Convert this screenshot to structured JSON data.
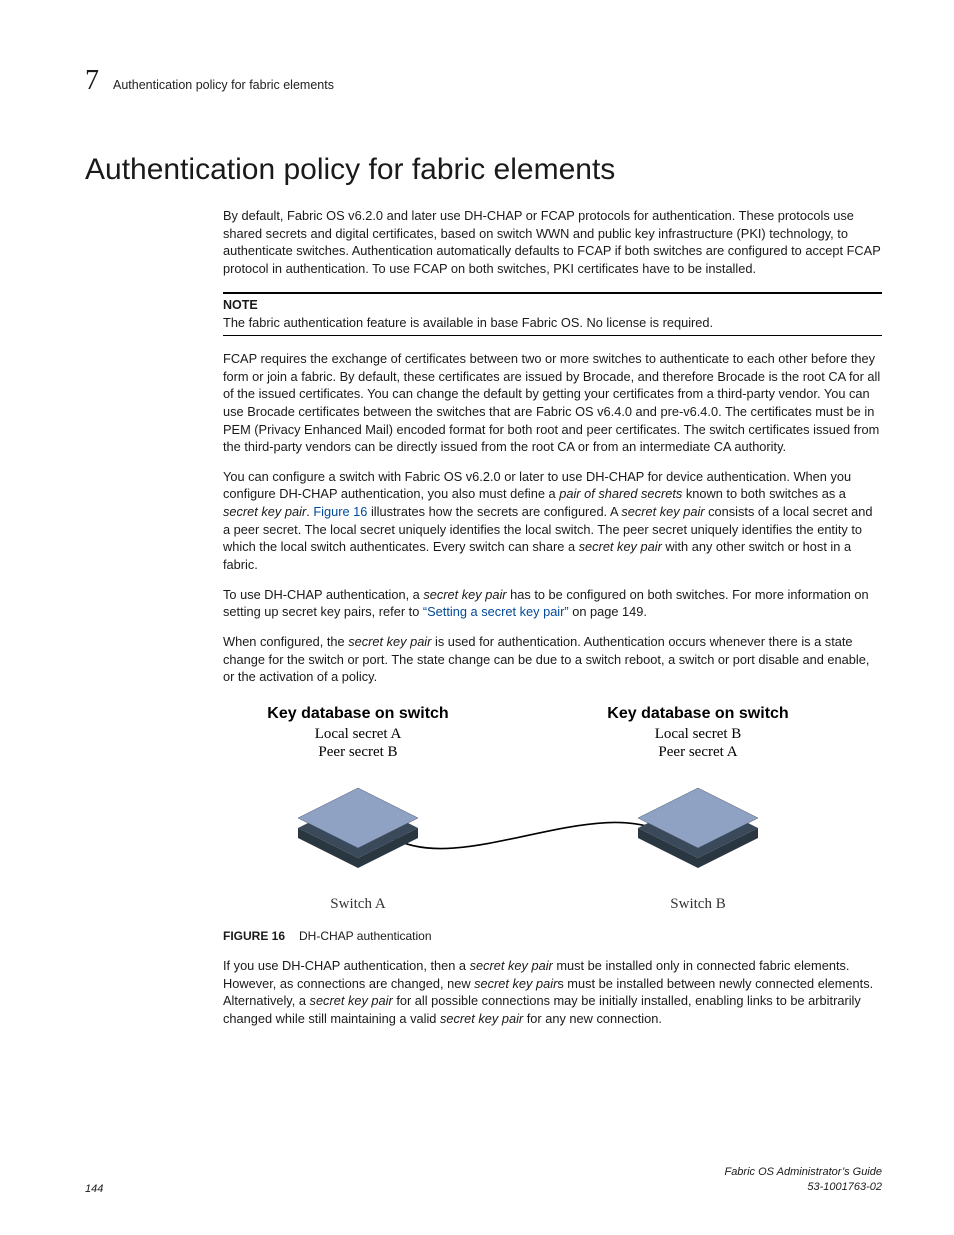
{
  "header": {
    "chapter_number": "7",
    "running_head": "Authentication policy for fabric elements"
  },
  "title": "Authentication policy for fabric elements",
  "paras": {
    "intro": "By default, Fabric OS v6.2.0 and later use DH-CHAP or FCAP protocols for authentication. These protocols use shared secrets and digital certificates, based on switch WWN and public key infrastructure (PKI) technology, to authenticate switches. Authentication automatically defaults to FCAP if both switches are configured to accept FCAP protocol in authentication. To use FCAP on both switches, PKI certificates have to be installed.",
    "fcap": "FCAP requires the exchange of certificates between two or more switches to authenticate to each other before they form or join a fabric. By default, these certificates are issued by Brocade, and therefore Brocade is the root CA for all of the issued certificates. You can change the default by getting your certificates from a third-party vendor. You can use Brocade certificates between the switches that are Fabric OS v6.4.0 and pre-v6.4.0. The certificates must be in PEM (Privacy Enhanced Mail) encoded format for both root and peer certificates. The switch certificates issued from the third-party vendors can be directly issued from the root CA or from an intermediate CA authority.",
    "dhchap_a": "You can configure a switch with Fabric OS v6.2.0 or later to use DH-CHAP for device authentication. When you configure DH-CHAP authentication, you also must define a ",
    "dhchap_b": "pair of shared secrets",
    "dhchap_c": " known to both switches as a ",
    "dhchap_d": "secret key pair",
    "dhchap_e": ". ",
    "dhchap_link": "Figure 16",
    "dhchap_f": " illustrates how the secrets are configured. A ",
    "dhchap_g": "secret key pair",
    "dhchap_h": " consists of a local secret and a peer secret. The local secret uniquely identifies the local switch. The peer secret uniquely identifies the entity to which the local switch authenticates. Every switch can share a ",
    "dhchap_i": "secret key pair",
    "dhchap_j": " with any other switch or host in a fabric.",
    "use_a": "To use DH-CHAP authentication, a ",
    "use_b": "secret key pair",
    "use_c": " has to be configured on both switches. For more information on setting up secret key pairs, refer to ",
    "use_link": "“Setting a secret key pair”",
    "use_d": " on page 149.",
    "conf_a": "When configured, the ",
    "conf_b": "secret key pair",
    "conf_c": " is used for authentication. Authentication occurs whenever there is a state change for the switch or port. The state change can be due to a switch reboot, a switch or port disable and enable, or the activation of a policy.",
    "after_a": "If you use DH-CHAP authentication, then a ",
    "after_b": "secret key pair",
    "after_c": " must be installed only in connected fabric elements. However, as connections are changed, new ",
    "after_d": "secret key pair",
    "after_e": "s must be installed between newly connected elements. Alternatively, a ",
    "after_f": "secret key pair",
    "after_g": " for all possible connections may be initially installed, enabling links to be arbitrarily changed while still maintaining a valid ",
    "after_h": "secret key pair",
    "after_i": " for any new connection."
  },
  "note": {
    "label": "NOTE",
    "body": "The fabric authentication feature is available in base Fabric OS. No license is required."
  },
  "figure": {
    "left_title": "Key database on switch",
    "left_line1": "Local secret A",
    "left_line2": "Peer secret B",
    "left_caption": "Switch A",
    "right_title": "Key database on switch",
    "right_line1": "Local secret B",
    "right_line2": "Peer secret A",
    "right_caption": "Switch B",
    "label": "FIGURE 16",
    "caption": "DH-CHAP authentication"
  },
  "footer": {
    "page": "144",
    "guide": "Fabric OS Administrator’s Guide",
    "docnum": "53-1001763-02"
  }
}
